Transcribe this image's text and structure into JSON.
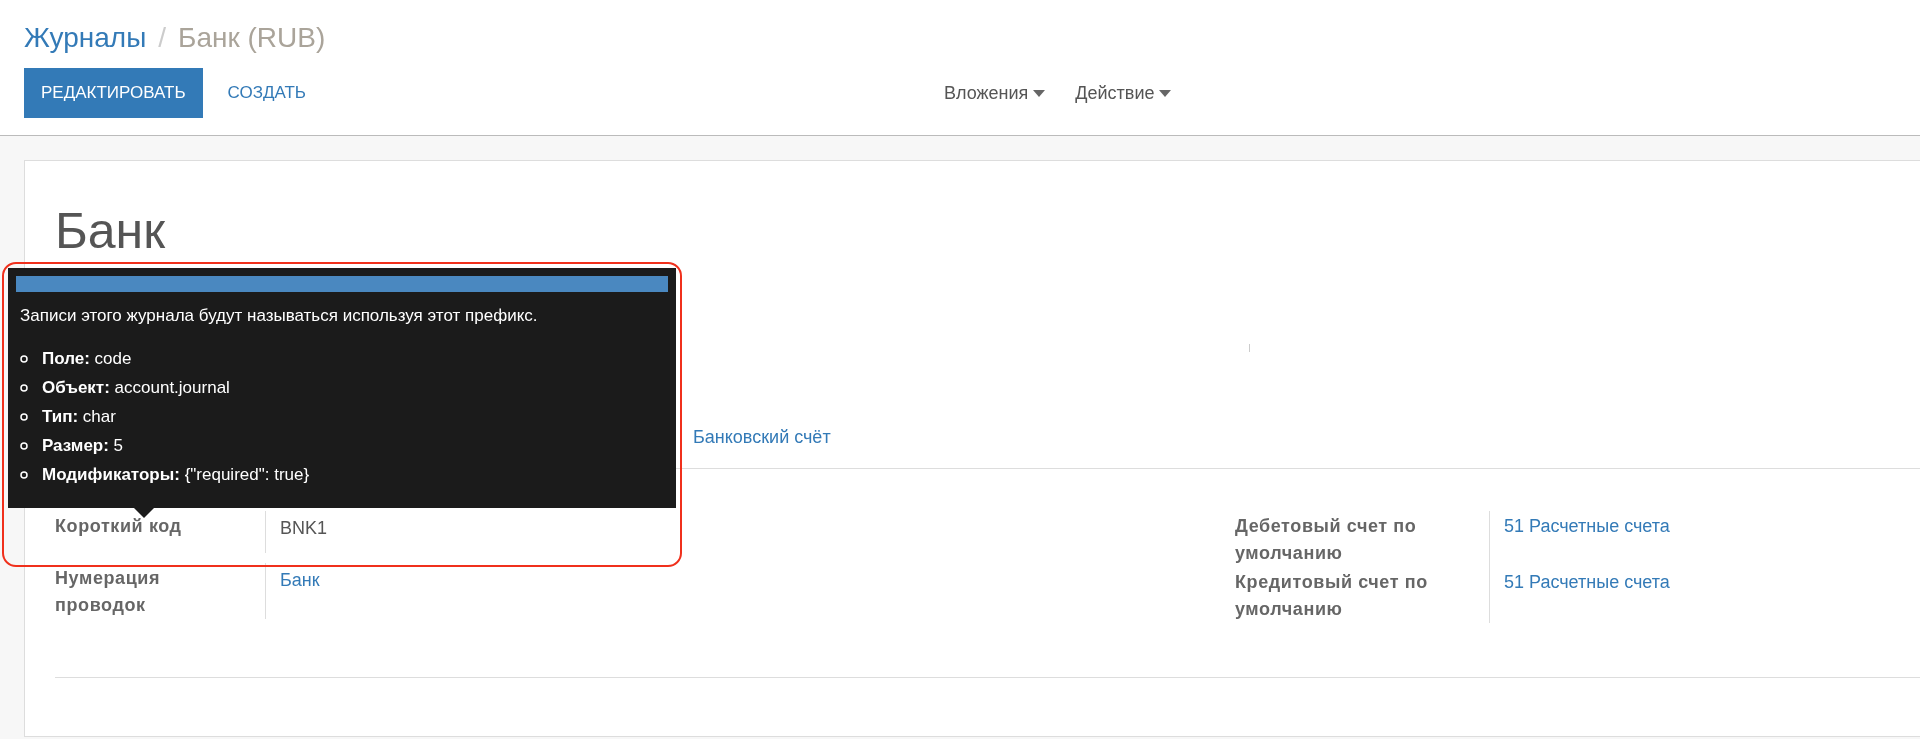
{
  "breadcrumb": {
    "parent": "Журналы",
    "separator": "/",
    "current": "Банк (RUB)"
  },
  "buttons": [
    {
      "label": "РЕДАКТИРОВАТЬ",
      "kind": "primary"
    },
    {
      "label": "СОЗДАТЬ",
      "kind": "link"
    }
  ],
  "dropdowns": [
    "Вложения",
    "Действие"
  ],
  "record": {
    "title": "Банк"
  },
  "tabs": [
    {
      "label": "Банковский счёт",
      "selected": false
    }
  ],
  "left_fields": [
    {
      "label": "Короткий код",
      "value": "BNK1",
      "link": false
    },
    {
      "label": "Нумерация проводок",
      "value": "Банк",
      "link": true
    }
  ],
  "right_fields": [
    {
      "label": "Дебетовый счет по умолчанию",
      "value": "51 Расчетные счета",
      "link": true
    },
    {
      "label": "Кредитовый счет по умолчанию",
      "value": "51 Расчетные счета",
      "link": true
    }
  ],
  "tooltip": {
    "text": "Записи этого журнала будут называться используя этот префикс.",
    "items": [
      "**Поле:** code",
      "**Объект:** account.journal",
      "**Тип:** char",
      "**Размер:** 5",
      "**Модификаторы:** {\"required\": true}"
    ]
  }
}
